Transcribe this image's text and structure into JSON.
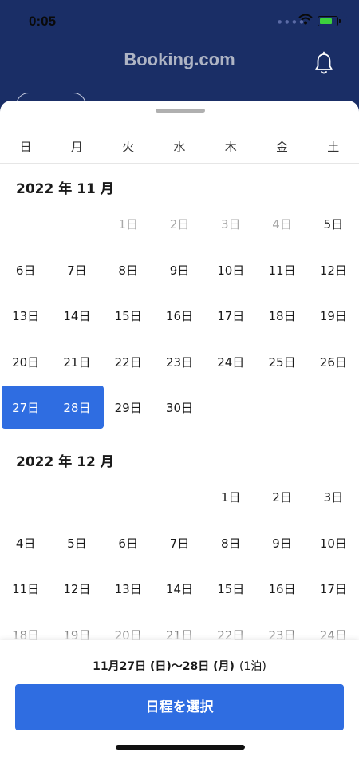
{
  "status": {
    "time": "0:05"
  },
  "header": {
    "brand": "Booking.com",
    "bell_icon": "bell-icon"
  },
  "weekdays": [
    "日",
    "月",
    "火",
    "水",
    "木",
    "金",
    "土"
  ],
  "months": [
    {
      "title": "2022 年 11 月",
      "weeks": [
        [
          null,
          null,
          "1日",
          "2日",
          "3日",
          "4日",
          "5日"
        ],
        [
          "6日",
          "7日",
          "8日",
          "9日",
          "10日",
          "11日",
          "12日"
        ],
        [
          "13日",
          "14日",
          "15日",
          "16日",
          "17日",
          "18日",
          "19日"
        ],
        [
          "20日",
          "21日",
          "22日",
          "23日",
          "24日",
          "25日",
          "26日"
        ],
        [
          "27日",
          "28日",
          "29日",
          "30日",
          null,
          null,
          null
        ]
      ],
      "disabled": [
        "1日",
        "2日",
        "3日",
        "4日"
      ],
      "selected": [
        "27日",
        "28日"
      ]
    },
    {
      "title": "2022 年 12 月",
      "weeks": [
        [
          null,
          null,
          null,
          null,
          "1日",
          "2日",
          "3日"
        ],
        [
          "4日",
          "5日",
          "6日",
          "7日",
          "8日",
          "9日",
          "10日"
        ],
        [
          "11日",
          "12日",
          "13日",
          "14日",
          "15日",
          "16日",
          "17日"
        ],
        [
          "18日",
          "19日",
          "20日",
          "21日",
          "22日",
          "23日",
          "24日"
        ]
      ],
      "disabled": [],
      "selected": []
    }
  ],
  "footer": {
    "summary": "11月27日 (日)〜28日 (月)",
    "nights": "(1泊)",
    "select_label": "日程を選択"
  },
  "colors": {
    "header": "#1a2e66",
    "accent": "#2f6de1"
  }
}
